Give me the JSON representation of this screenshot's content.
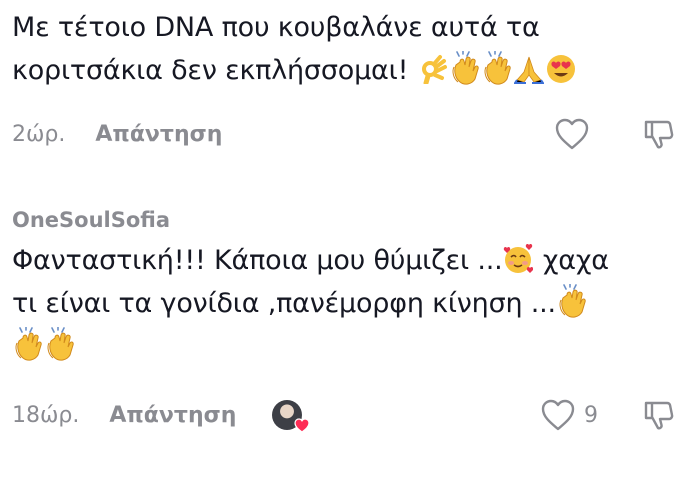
{
  "comments": [
    {
      "text_line1": "Με τέτοιο DNA που κουβαλάνε αυτά τα",
      "text_line2": "κοριτσάκια δεν εκπλήσσομαι!",
      "time": "2ώρ.",
      "reply_label": "Απάντηση"
    },
    {
      "username": "OneSoulSofia",
      "text_line1_a": "Φανταστική!!! Κάποια μου θύμιζει ...",
      "text_line1_b": " χαχα",
      "text_line2": "τι είναι τα γονίδια ,πανέμορφη κίνηση ...",
      "time": "18ώρ.",
      "reply_label": "Απάντηση",
      "like_count": "9"
    }
  ],
  "icons": {
    "like": "heart-outline-icon",
    "dislike": "thumbs-down-outline-icon",
    "emoji": [
      "ok-hand-emoji",
      "clapping-hands-emoji",
      "folded-hands-emoji",
      "heart-eyes-emoji",
      "smiling-face-with-hearts-emoji"
    ]
  },
  "colors": {
    "text": "#161823",
    "muted": "#8a8b91",
    "heart_badge": "#fe2c55",
    "emoji_yellow": "#f7c23b"
  }
}
